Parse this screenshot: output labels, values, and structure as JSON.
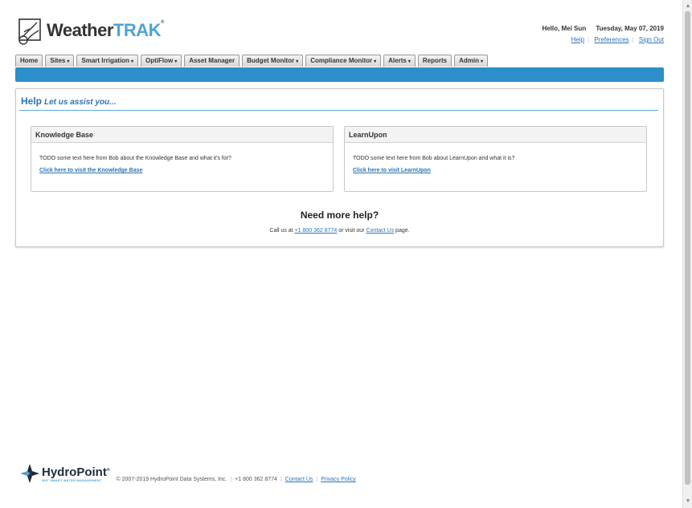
{
  "brand": {
    "name_dark": "Weather",
    "name_light": "TRAK",
    "mark": "®"
  },
  "user": {
    "greeting": "Hello, Mei Sun",
    "date": "Tuesday, May 07, 2019"
  },
  "user_links": {
    "help": "Help",
    "preferences": "Preferences",
    "sign_out": "Sign Out"
  },
  "nav": {
    "home": "Home",
    "sites": "Sites",
    "smart_irrigation": "Smart Irrigation",
    "optiflow": "OptiFlow",
    "asset_manager": "Asset Manager",
    "budget_monitor": "Budget Monitor",
    "compliance_monitor": "Compliance Monitor",
    "alerts": "Alerts",
    "reports": "Reports",
    "admin": "Admin",
    "caret": "▾"
  },
  "page": {
    "title": "Help",
    "subtitle": "Let us assist you..."
  },
  "cards": {
    "knowledge_base": {
      "title": "Knowledge Base",
      "text": "TODO some text here from Bob about the Knowledge Base and what it's for?",
      "link": "Click here to visit the Knowledge Base"
    },
    "learnupon": {
      "title": "LearnUpon",
      "text": "TODO some text here from Bob about LearnUpon and what it is?",
      "link": "Click here to visit LearnUpon"
    }
  },
  "help": {
    "heading": "Need more help?",
    "call_prefix": "Call us at ",
    "phone": "+1 800 362 8774",
    "call_middle": " or visit our ",
    "contact_link": "Contact Us",
    "call_suffix": " page."
  },
  "footer": {
    "logo_name": "HydroPoint",
    "logo_mark": "®",
    "tagline": "360° SMART WATER MANAGEMENT",
    "copyright": "© 2007-2019 HydroPoint Data Systems, Inc.",
    "phone": "+1 800 362 8774",
    "contact": "Contact Us",
    "privacy": "Privacy Policy"
  },
  "colors": {
    "accent": "#2c8fc9",
    "link": "#2a74b5",
    "brand_light": "#4ea3d8"
  }
}
